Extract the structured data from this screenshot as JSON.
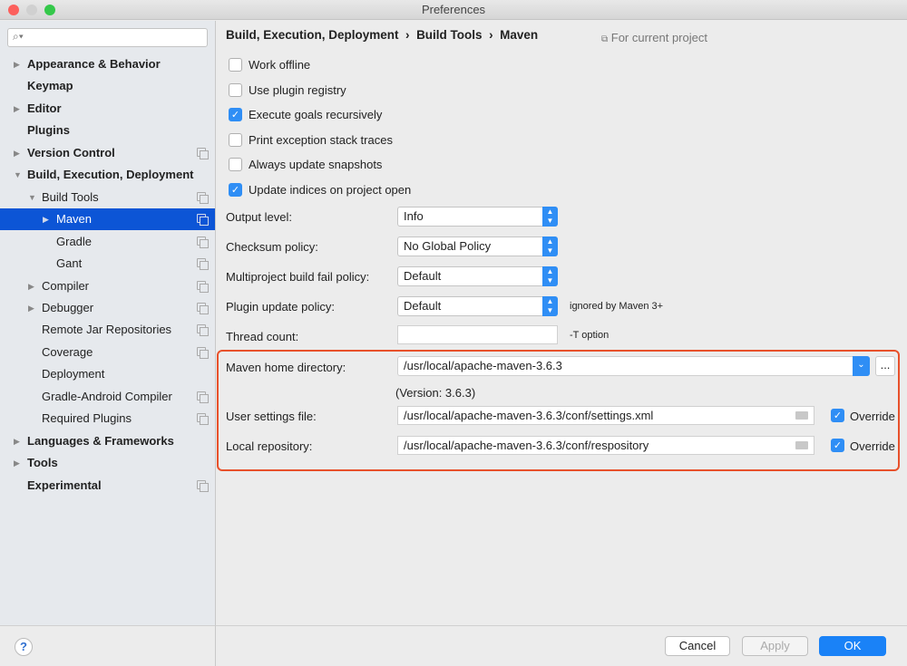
{
  "window": {
    "title": "Preferences"
  },
  "search": {
    "placeholder": ""
  },
  "sidebar": {
    "items": [
      {
        "label": "Appearance & Behavior"
      },
      {
        "label": "Keymap"
      },
      {
        "label": "Editor"
      },
      {
        "label": "Plugins"
      },
      {
        "label": "Version Control"
      },
      {
        "label": "Build, Execution, Deployment"
      },
      {
        "label": "Build Tools"
      },
      {
        "label": "Maven"
      },
      {
        "label": "Gradle"
      },
      {
        "label": "Gant"
      },
      {
        "label": "Compiler"
      },
      {
        "label": "Debugger"
      },
      {
        "label": "Remote Jar Repositories"
      },
      {
        "label": "Coverage"
      },
      {
        "label": "Deployment"
      },
      {
        "label": "Gradle-Android Compiler"
      },
      {
        "label": "Required Plugins"
      },
      {
        "label": "Languages & Frameworks"
      },
      {
        "label": "Tools"
      },
      {
        "label": "Experimental"
      }
    ]
  },
  "breadcrumb": {
    "items": [
      "Build, Execution, Deployment",
      "Build Tools",
      "Maven"
    ],
    "sep": "›",
    "scope": "For current project"
  },
  "checkboxes": [
    {
      "label": "Work offline",
      "checked": false
    },
    {
      "label": "Use plugin registry",
      "checked": false
    },
    {
      "label": "Execute goals recursively",
      "checked": true
    },
    {
      "label": "Print exception stack traces",
      "checked": false
    },
    {
      "label": "Always update snapshots",
      "checked": false
    },
    {
      "label": "Update indices on project open",
      "checked": true
    }
  ],
  "settings": {
    "output_level": {
      "label": "Output level:",
      "value": "Info"
    },
    "checksum": {
      "label": "Checksum policy:",
      "value": "No Global Policy"
    },
    "multiproject": {
      "label": "Multiproject build fail policy:",
      "value": "Default"
    },
    "plugin_update": {
      "label": "Plugin update policy:",
      "value": "Default",
      "hint": "ignored by Maven 3+"
    },
    "thread_count": {
      "label": "Thread count:",
      "value": "",
      "hint": "-T option"
    },
    "maven_home": {
      "label": "Maven home directory:",
      "value": "/usr/local/apache-maven-3.6.3",
      "browse": "...",
      "version": "(Version: 3.6.3)"
    },
    "user_settings": {
      "label": "User settings file:",
      "value": "/usr/local/apache-maven-3.6.3/conf/settings.xml",
      "override": "Override"
    },
    "local_repo": {
      "label": "Local repository:",
      "value": "/usr/local/apache-maven-3.6.3/conf/respository",
      "override": "Override"
    }
  },
  "buttons": {
    "help": "?",
    "cancel": "Cancel",
    "apply": "Apply",
    "ok": "OK"
  },
  "colors": {
    "accent": "#2f8ef5",
    "selection": "#0c55d6",
    "highlight_box": "#e8512b"
  }
}
